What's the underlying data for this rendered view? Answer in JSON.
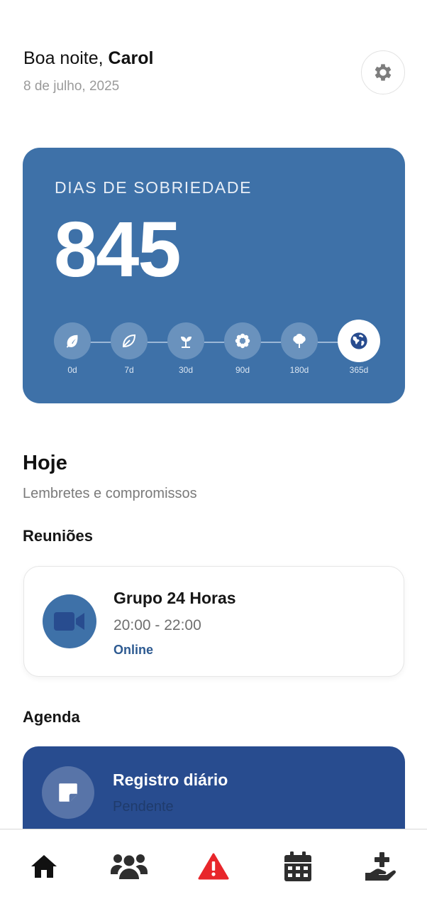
{
  "header": {
    "greeting_prefix": "Boa noite, ",
    "user_name": "Carol",
    "date": "8 de julho, 2025",
    "settings_icon": "gear-icon"
  },
  "sobriety": {
    "label": "DIAS DE SOBRIEDADE",
    "count": "845",
    "milestones": [
      {
        "label": "0d",
        "icon": "leaf-icon",
        "reached": true
      },
      {
        "label": "7d",
        "icon": "leaf-icon",
        "reached": true
      },
      {
        "label": "30d",
        "icon": "seedling-icon",
        "reached": true
      },
      {
        "label": "90d",
        "icon": "flower-icon",
        "reached": true
      },
      {
        "label": "180d",
        "icon": "tree-icon",
        "reached": true
      },
      {
        "label": "365d",
        "icon": "globe-icon",
        "reached": true,
        "current": true
      }
    ]
  },
  "today": {
    "title": "Hoje",
    "subtitle": "Lembretes e compromissos",
    "meetings_heading": "Reuniões",
    "meeting": {
      "title": "Grupo 24 Horas",
      "time": "20:00 - 22:00",
      "mode": "Online",
      "icon": "video-camera-icon"
    },
    "agenda_heading": "Agenda",
    "agenda_item": {
      "title": "Registro diário",
      "status": "Pendente",
      "icon": "note-icon"
    }
  },
  "bottom_nav": [
    {
      "icon": "home-icon",
      "active": true
    },
    {
      "icon": "users-icon"
    },
    {
      "icon": "alert-triangle-icon"
    },
    {
      "icon": "calendar-icon"
    },
    {
      "icon": "hand-plus-icon"
    }
  ],
  "colors": {
    "card_blue": "#3e71a8",
    "agenda_blue": "#284c8f",
    "alert_red": "#e8262b",
    "icon_dark": "#2e2e2e"
  }
}
